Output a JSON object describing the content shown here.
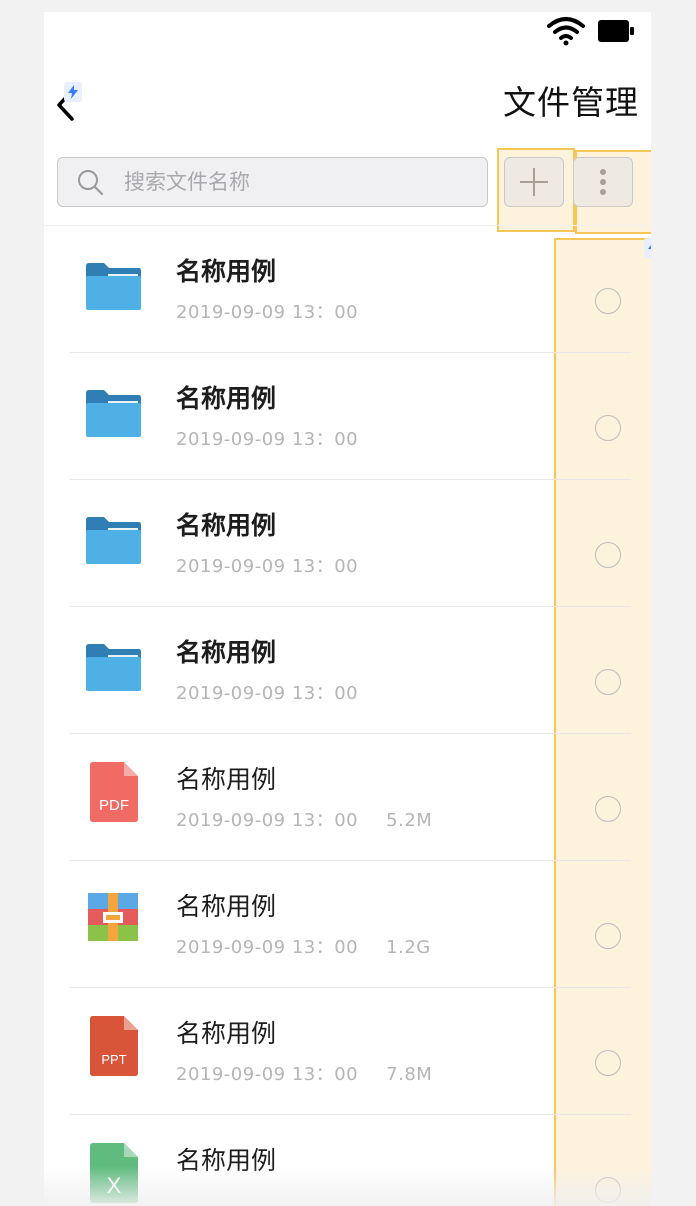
{
  "header": {
    "title": "文件管理",
    "back_icon": "chevron-left-icon"
  },
  "search": {
    "placeholder": "搜索文件名称"
  },
  "toolbar": {
    "add_icon": "plus-icon",
    "more_icon": "more-vertical-icon"
  },
  "files": [
    {
      "name": "名称用例",
      "date": "2019-09-09 13：00",
      "size": "",
      "type": "folder",
      "bold": true
    },
    {
      "name": "名称用例",
      "date": "2019-09-09 13：00",
      "size": "",
      "type": "folder",
      "bold": true
    },
    {
      "name": "名称用例",
      "date": "2019-09-09 13：00",
      "size": "",
      "type": "folder",
      "bold": true
    },
    {
      "name": "名称用例",
      "date": "2019-09-09 13：00",
      "size": "",
      "type": "folder",
      "bold": true
    },
    {
      "name": "名称用例",
      "date": "2019-09-09 13：00",
      "size": "5.2M",
      "type": "pdf",
      "bold": false,
      "icon_text": "PDF"
    },
    {
      "name": "名称用例",
      "date": "2019-09-09 13：00",
      "size": "1.2G",
      "type": "archive",
      "bold": false
    },
    {
      "name": "名称用例",
      "date": "2019-09-09 13：00",
      "size": "7.8M",
      "type": "ppt",
      "bold": false,
      "icon_text": "PPT"
    },
    {
      "name": "名称用例",
      "date": "",
      "size": "",
      "type": "excel",
      "bold": false,
      "icon_text": "X"
    }
  ],
  "colors": {
    "folder": "#4fb0e6",
    "folder_tab": "#2f7fb4",
    "pdf": "#ef6b63",
    "ppt": "#d9553a",
    "excel": "#5fbb7e",
    "highlight": "#fdf2dc",
    "highlight_border": "#f6c659"
  }
}
